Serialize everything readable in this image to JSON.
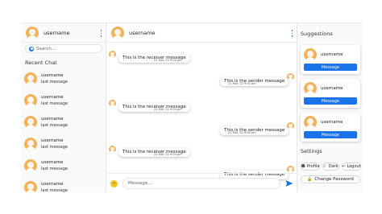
{
  "left": {
    "username": "username",
    "search_placeholder": "Search...",
    "recent_title": "Recent Chat",
    "chats": [
      {
        "username": "username",
        "last": "last message"
      },
      {
        "username": "username",
        "last": "last message"
      },
      {
        "username": "username",
        "last": "last message"
      },
      {
        "username": "username",
        "last": "last message"
      },
      {
        "username": "username",
        "last": "last message"
      },
      {
        "username": "username",
        "last": "last message"
      }
    ]
  },
  "middle": {
    "username": "username",
    "messages": [
      {
        "type": "received",
        "text": "This is the receiver message",
        "time": "21 Mar, 22   9:00 pm"
      },
      {
        "type": "sent",
        "text": "This is the sender message",
        "time": "21 Mar, 22   9:00 pm"
      },
      {
        "type": "received",
        "text": "This is the receiver message",
        "time": "21 Mar, 22   9:00 pm"
      },
      {
        "type": "sent",
        "text": "This is the sender message",
        "time": "21 Mar, 22   9:00 pm"
      },
      {
        "type": "received",
        "text": "This is the receiver message",
        "time": "21 Mar, 22   9:00 pm"
      },
      {
        "type": "sent",
        "text": "This is the sender message",
        "time": ""
      }
    ],
    "input_placeholder": "Message..."
  },
  "right": {
    "suggestions_title": "Suggestions",
    "suggestions": [
      {
        "username": "username",
        "button": "Message"
      },
      {
        "username": "username",
        "button": "Message"
      },
      {
        "username": "username",
        "button": "Message"
      }
    ],
    "settings_title": "Settings",
    "profile_label": "Profile",
    "dark_label": "Dark",
    "logout_label": "Logout",
    "change_password_label": "Change Password"
  },
  "colors": {
    "accent": "#1a73e8",
    "avatar": "#f2b25a"
  }
}
